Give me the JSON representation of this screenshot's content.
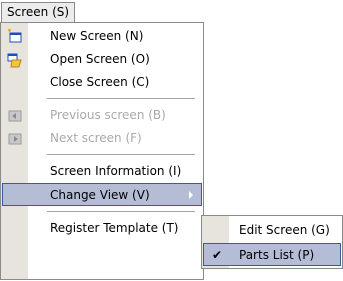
{
  "menubar": {
    "title": "Screen (S)"
  },
  "menu": {
    "items": [
      {
        "label": "New Screen (N)",
        "icon": "new-screen-icon",
        "enabled": true
      },
      {
        "label": "Open Screen (O)",
        "icon": "open-screen-icon",
        "enabled": true
      },
      {
        "label": "Close Screen (C)",
        "icon": "",
        "enabled": true
      },
      {
        "label": "Previous screen (B)",
        "icon": "previous-screen-icon",
        "enabled": false
      },
      {
        "label": "Next screen (F)",
        "icon": "next-screen-icon",
        "enabled": false
      },
      {
        "label": "Screen Information (I)",
        "icon": "",
        "enabled": true
      },
      {
        "label": "Change View (V)",
        "icon": "",
        "enabled": true,
        "selected": true,
        "has_submenu": true
      },
      {
        "label": "Register Template (T)",
        "icon": "",
        "enabled": true
      }
    ]
  },
  "submenu": {
    "items": [
      {
        "label": "Edit Screen (G)",
        "checked": false
      },
      {
        "label": "Parts List (P)",
        "checked": true,
        "check_mark": "✔"
      }
    ]
  },
  "colors": {
    "highlight": "#b5bdd6",
    "highlight_border": "#3e5a9e",
    "gutter": "#e7e4dd",
    "disabled_text": "#a9a9a9"
  }
}
